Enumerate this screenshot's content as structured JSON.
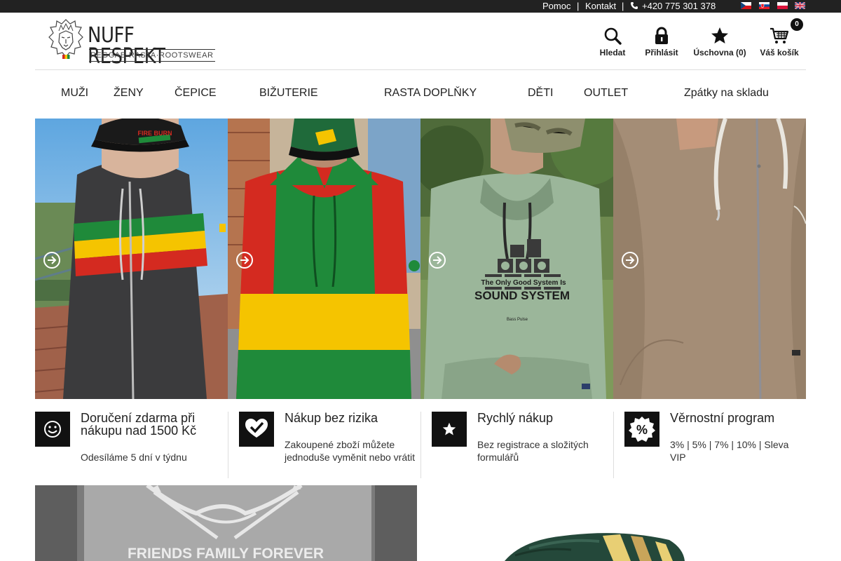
{
  "topbar": {
    "help": "Pomoc",
    "contact": "Kontakt",
    "separator": "|",
    "phone": "+420 775 301 378",
    "languages": [
      "cz",
      "sk",
      "pl",
      "en"
    ]
  },
  "logo": {
    "name": "NUFF RESPEKT",
    "tagline": "REGGAE·RASTA·ROOTSWEAR"
  },
  "header_tools": {
    "search": "Hledat",
    "login": "Přihlásit",
    "wishlist": "Úschovna (0)",
    "cart": "Váš košík",
    "cart_count": "0"
  },
  "nav": {
    "items": [
      "MUŽI",
      "ŽENY",
      "ČEPICE",
      "BIŽUTERIE",
      "RASTA DOPLŇKY",
      "DĚTI",
      "OUTLET",
      "Zpátky na skladu"
    ]
  },
  "banners": [
    {
      "cap_text": "FIRE BURN"
    },
    {},
    {
      "print_text_1": "The Only Good System Is",
      "print_text_2": "SOUND SYSTEM",
      "print_text_3": "Bass Pulse"
    },
    {}
  ],
  "features": [
    {
      "icon": "smiley-icon",
      "title": "Doručení zdarma při nákupu nad 1500 Kč",
      "title_line1": "Doručení zdarma při",
      "title_line2": "nákupu nad 1500 Kč",
      "desc": "Odesíláme 5 dní v týdnu"
    },
    {
      "icon": "checkmark-icon",
      "title": "Nákup bez rizika",
      "desc_line1": "Zakoupené zboží můžete",
      "desc_line2": "jednoduše vyměnit nebo vrátit"
    },
    {
      "icon": "star-icon",
      "title": "Rychlý nákup",
      "desc_line1": "Bez registrace a složitých",
      "desc_line2": "formulářů"
    },
    {
      "icon": "percent-icon",
      "title": "Věrnostní program",
      "desc_line1": "3% | 5% | 7% | 10% | Sleva",
      "desc_line2": "VIP"
    }
  ],
  "lower_banners": [
    {
      "print_text": "FRIENDS FAMILY FOREVER"
    },
    {}
  ],
  "colors": {
    "topbar": "#222222",
    "rasta_red": "#d42a20",
    "rasta_yellow": "#f5c400",
    "rasta_green": "#1f8a3a",
    "icon_box": "#111111"
  }
}
